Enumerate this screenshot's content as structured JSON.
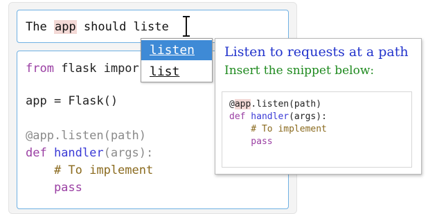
{
  "prompt": {
    "before": "The ",
    "highlight": "app",
    "after": " should liste"
  },
  "editor": {
    "line1_kw": "from",
    "line1_rest": " flask impor",
    "line2": "app = Flask()",
    "line3": "@app.listen(path)",
    "line4_kw": "def",
    "line4_fn": " handler",
    "line4_rest": "(args):",
    "line5": "    # To implement",
    "line6": "    pass"
  },
  "autocomplete": {
    "items": [
      "listen",
      "list"
    ],
    "selected_index": 0
  },
  "tooltip": {
    "title": "Listen to requests at a path",
    "subtitle": "Insert the snippet below:",
    "snippet": {
      "line1_pre": "@",
      "line1_hl": "app",
      "line1_post": ".listen(path)",
      "line2_kw": "def",
      "line2_fn": " handler",
      "line2_rest": "(args):",
      "line3": "    # To implement",
      "line4": "    pass"
    }
  },
  "colors": {
    "accent_border": "#6fb0e3",
    "selection": "#3e8ad6",
    "keyword": "#9a3fa3",
    "function": "#3a3ad6",
    "comment": "#8a6a1e",
    "title": "#2233cc",
    "subtitle": "#1f8a1f"
  }
}
